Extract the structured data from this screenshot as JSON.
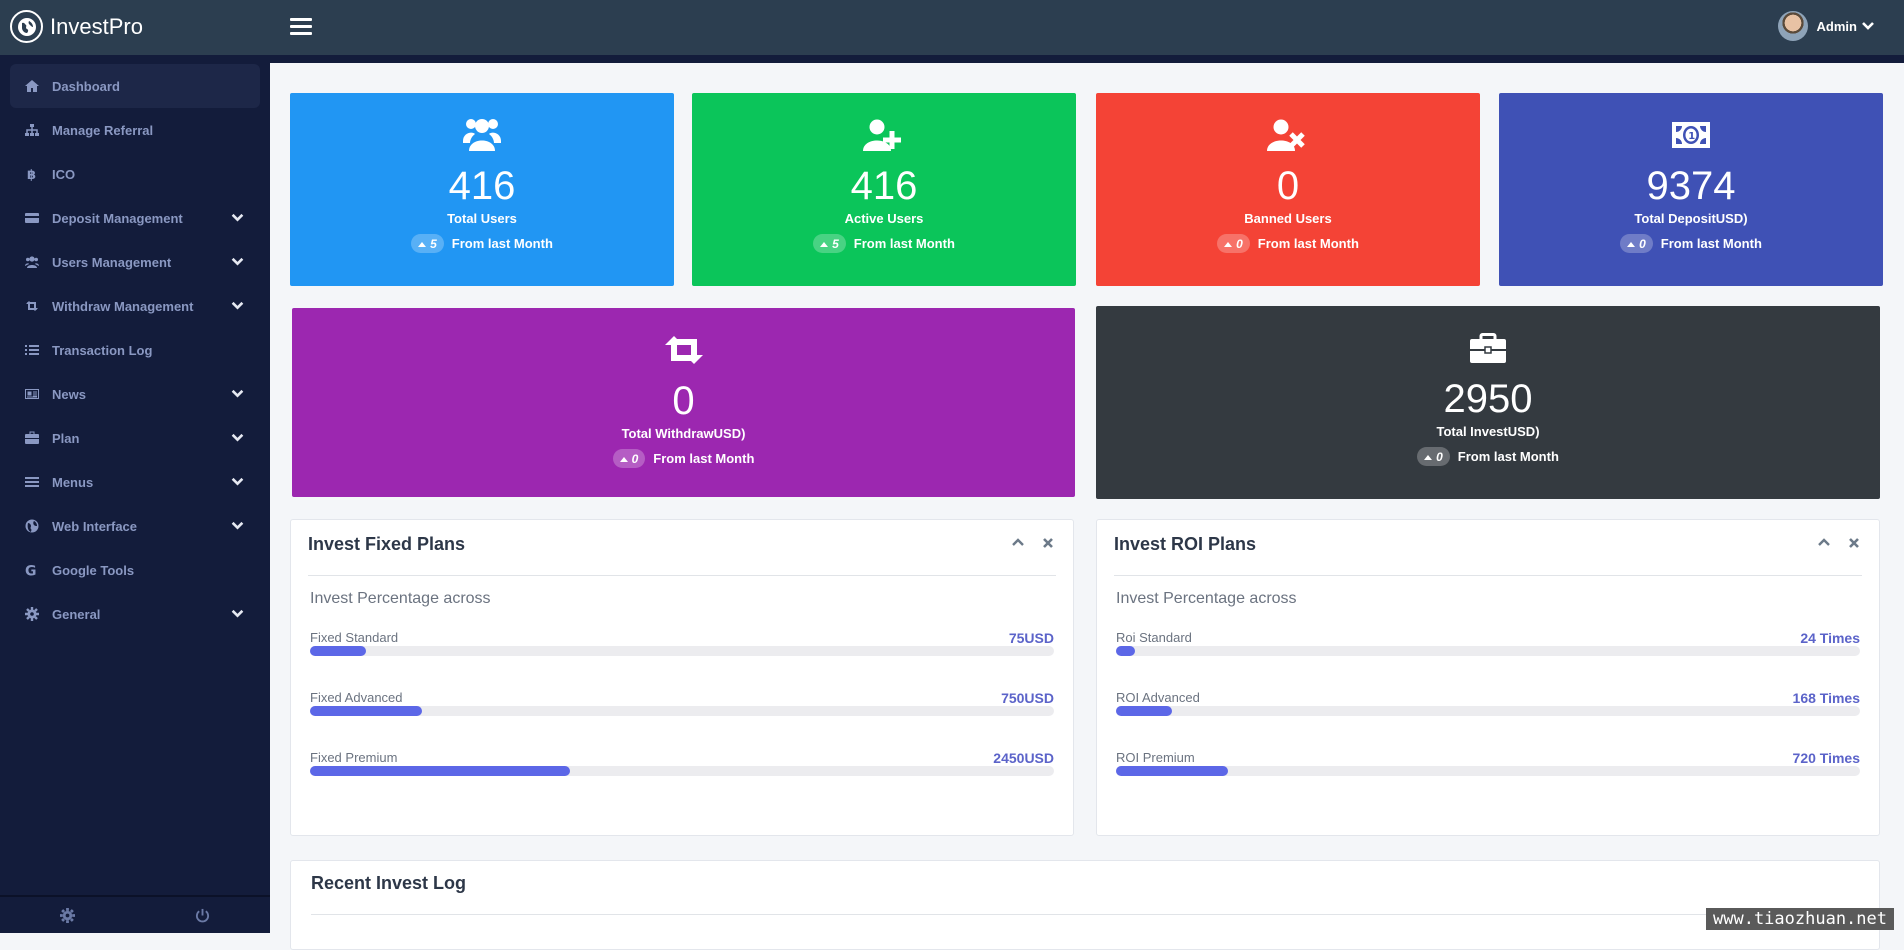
{
  "header": {
    "brand": "InvestPro",
    "user_name": "Admin"
  },
  "sidebar": {
    "items": [
      {
        "label": "Dashboard",
        "icon": "home-icon",
        "active": true,
        "has_submenu": false
      },
      {
        "label": "Manage Referral",
        "icon": "sitemap-icon",
        "has_submenu": false
      },
      {
        "label": "ICO",
        "icon": "bitcoin-icon",
        "has_submenu": false
      },
      {
        "label": "Deposit Management",
        "icon": "credit-card-icon",
        "has_submenu": true
      },
      {
        "label": "Users Management",
        "icon": "users-icon",
        "has_submenu": true
      },
      {
        "label": "Withdraw Management",
        "icon": "retweet-icon",
        "has_submenu": true
      },
      {
        "label": "Transaction Log",
        "icon": "list-icon",
        "has_submenu": false
      },
      {
        "label": "News",
        "icon": "newspaper-icon",
        "has_submenu": true
      },
      {
        "label": "Plan",
        "icon": "briefcase-icon",
        "has_submenu": true
      },
      {
        "label": "Menus",
        "icon": "bars-icon",
        "has_submenu": true
      },
      {
        "label": "Web Interface",
        "icon": "globe-icon",
        "has_submenu": true
      },
      {
        "label": "Google Tools",
        "icon": "google-icon",
        "has_submenu": false
      },
      {
        "label": "General",
        "icon": "gear-icon",
        "has_submenu": true
      }
    ]
  },
  "stats": [
    {
      "value": "416",
      "label": "Total Users",
      "change": "5",
      "change_text": "From last Month",
      "color": "#2196f3",
      "icon": "users-icon"
    },
    {
      "value": "416",
      "label": "Active Users",
      "change": "5",
      "change_text": "From last Month",
      "color": "#0bc55a",
      "icon": "user-plus-icon"
    },
    {
      "value": "0",
      "label": "Banned Users",
      "change": "0",
      "change_text": "From last Month",
      "color": "#f44336",
      "icon": "user-times-icon"
    },
    {
      "value": "9374",
      "label": "Total DepositUSD)",
      "change": "0",
      "change_text": "From last Month",
      "color": "#3f51b5",
      "icon": "money-bill-icon"
    },
    {
      "value": "0",
      "label": "Total WithdrawUSD)",
      "change": "0",
      "change_text": "From last Month",
      "color": "#9c27b0",
      "icon": "retweet-icon"
    },
    {
      "value": "2950",
      "label": "Total InvestUSD)",
      "change": "0",
      "change_text": "From last Month",
      "color": "#343a40",
      "icon": "briefcase-icon"
    }
  ],
  "fixed_plans": {
    "title": "Invest Fixed Plans",
    "subtitle": "Invest Percentage across",
    "rows": [
      {
        "label": "Fixed Standard",
        "value": "75USD",
        "percent": 7.5
      },
      {
        "label": "Fixed Advanced",
        "value": "750USD",
        "percent": 15
      },
      {
        "label": "Fixed Premium",
        "value": "2450USD",
        "percent": 35
      }
    ]
  },
  "roi_plans": {
    "title": "Invest ROI Plans",
    "subtitle": "Invest Percentage across",
    "rows": [
      {
        "label": "Roi Standard",
        "value": "24 Times",
        "percent": 2.5
      },
      {
        "label": "ROI Advanced",
        "value": "168 Times",
        "percent": 7.5
      },
      {
        "label": "ROI Premium",
        "value": "720 Times",
        "percent": 15
      }
    ]
  },
  "recent_log": {
    "title": "Recent Invest Log"
  },
  "watermark": "www.tiaozhuan.net"
}
